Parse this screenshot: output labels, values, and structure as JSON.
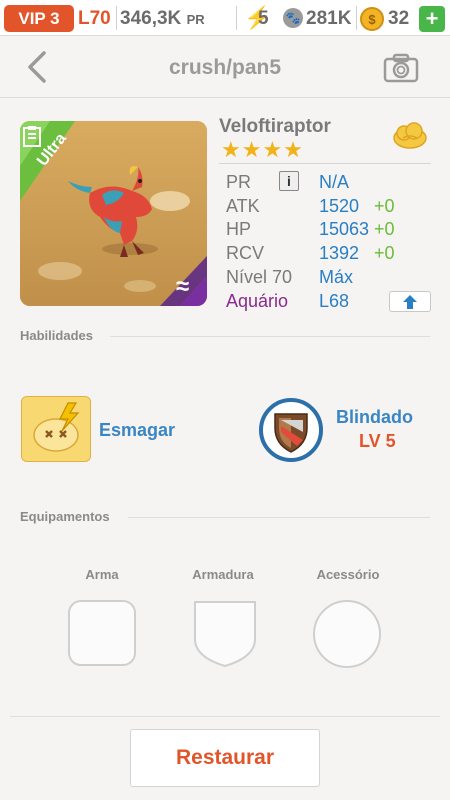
{
  "topbar": {
    "vip": "VIP 3",
    "level": "L70",
    "power": "346,3K",
    "power_unit": "PR",
    "energy": "5",
    "food": "281K",
    "coins": "32",
    "add_label": "+"
  },
  "nav": {
    "title": "crush/pan5"
  },
  "dino": {
    "badge": "Ultra",
    "name": "Veloftiraptor",
    "stars": "★★★★",
    "element": "≈",
    "stats": {
      "pr_label": "PR",
      "pr_value": "N/A",
      "atk_label": "ATK",
      "atk_value": "1520",
      "atk_bonus": "+0",
      "hp_label": "HP",
      "hp_value": "15063",
      "hp_bonus": "+0",
      "rcv_label": "RCV",
      "rcv_value": "1392",
      "rcv_bonus": "+0",
      "level_label": "Nível 70",
      "level_value": "Máx",
      "habitat_label": "Aquário",
      "habitat_value": "L68"
    }
  },
  "abilities": {
    "title": "Habilidades",
    "skill_name": "Esmagar",
    "passive_name": "Blindado",
    "passive_level": "LV 5"
  },
  "equipment": {
    "title": "Equipamentos",
    "weapon": "Arma",
    "armor": "Armadura",
    "accessory": "Acessório"
  },
  "actions": {
    "restore": "Restaurar"
  },
  "colors": {
    "accent_orange": "#e2552a",
    "link_blue": "#2a7fc4",
    "bonus_green": "#6bbd3a",
    "habitat_purple": "#8a2a8c",
    "star_gold": "#f2b21a"
  }
}
